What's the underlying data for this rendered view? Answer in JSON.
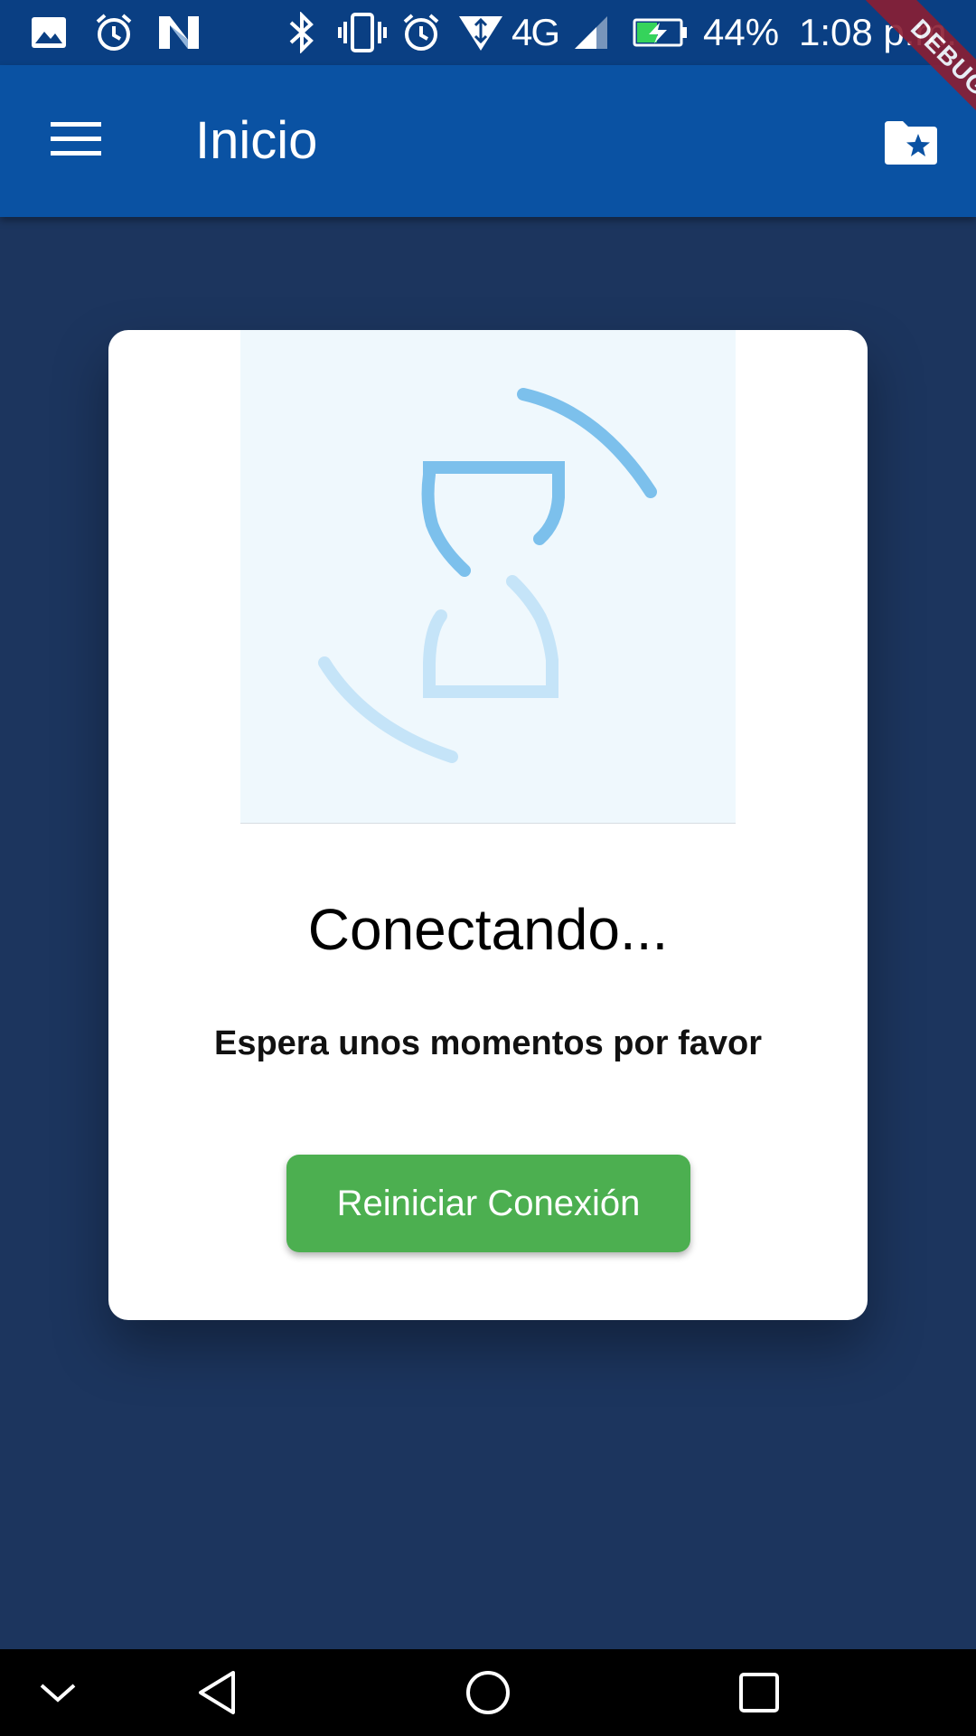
{
  "status_bar": {
    "battery": "44%",
    "time": "1:08 p.m.",
    "network": "4G",
    "icons": [
      "image-icon",
      "alarm-icon",
      "n-app-icon",
      "bluetooth-icon",
      "vibrate-icon",
      "alarm-icon",
      "data-transfer-icon",
      "signal-icon",
      "battery-charging-icon"
    ]
  },
  "app_bar": {
    "title": "Inicio",
    "menu_icon": "menu-icon",
    "action_icon": "folder-star-icon"
  },
  "debug_banner": "DEBUG",
  "card": {
    "title": "Conectando...",
    "subtitle": "Espera unos momentos por favor",
    "button_label": "Reiniciar Conexión",
    "illustration_icon": "hourglass-loading-icon"
  },
  "colors": {
    "status_bar": "#0a3f83",
    "app_bar": "#0a52a3",
    "background": "#1c355e",
    "button": "#4caf50",
    "illustration_bg": "#eff8fd",
    "icon_light_blue": "#7cc0ec",
    "icon_pale_blue": "#c5e4f8"
  },
  "nav_bar": {
    "icons": [
      "chevron-down-icon",
      "back-icon",
      "home-icon",
      "recents-icon"
    ]
  }
}
